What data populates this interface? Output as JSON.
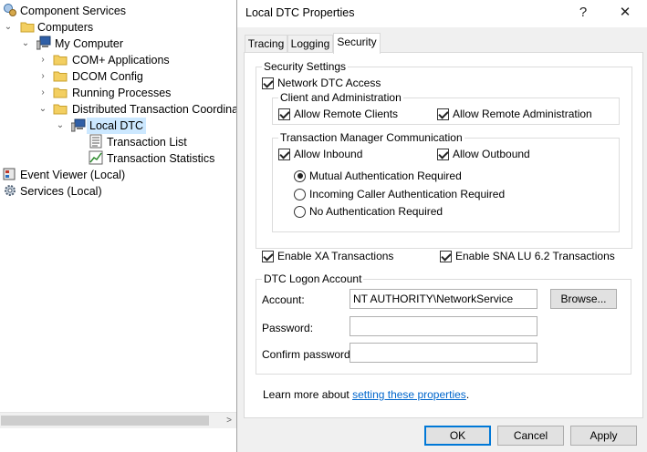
{
  "tree": {
    "items": [
      {
        "label": "Component Services",
        "icon": "component-services-icon",
        "expand": ""
      },
      {
        "label": "Computers",
        "icon": "folder-icon",
        "expand": "expanded"
      },
      {
        "label": "My Computer",
        "icon": "computer-icon",
        "expand": "expanded"
      },
      {
        "label": "COM+ Applications",
        "icon": "folder-icon",
        "expand": "collapsed"
      },
      {
        "label": "DCOM Config",
        "icon": "folder-icon",
        "expand": "collapsed"
      },
      {
        "label": "Running Processes",
        "icon": "folder-icon",
        "expand": "collapsed"
      },
      {
        "label": "Distributed Transaction Coordinat",
        "icon": "folder-icon",
        "expand": "expanded"
      },
      {
        "label": "Local DTC",
        "icon": "local-dtc-icon",
        "expand": "expanded",
        "selected": true
      },
      {
        "label": "Transaction List",
        "icon": "list-icon",
        "expand": ""
      },
      {
        "label": "Transaction Statistics",
        "icon": "statistics-icon",
        "expand": ""
      },
      {
        "label": "Event Viewer (Local)",
        "icon": "event-viewer-icon",
        "expand": ""
      },
      {
        "label": "Services (Local)",
        "icon": "services-gear-icon",
        "expand": ""
      }
    ]
  },
  "dialog": {
    "title": "Local DTC Properties",
    "help": "?",
    "close": "✕",
    "tabs": [
      "Tracing",
      "Logging",
      "Security"
    ],
    "active_tab": "Security",
    "security_settings": {
      "legend": "Security Settings",
      "network_dtc_access": {
        "label": "Network DTC Access",
        "checked": true
      },
      "client_admin": {
        "legend": "Client and Administration",
        "allow_remote_clients": {
          "label": "Allow Remote Clients",
          "checked": true
        },
        "allow_remote_admin": {
          "label": "Allow Remote Administration",
          "checked": true
        }
      },
      "tm_comm": {
        "legend": "Transaction Manager Communication",
        "allow_inbound": {
          "label": "Allow Inbound",
          "checked": true
        },
        "allow_outbound": {
          "label": "Allow Outbound",
          "checked": true
        },
        "auth_options": [
          {
            "label": "Mutual Authentication Required",
            "checked": true
          },
          {
            "label": "Incoming Caller Authentication Required",
            "checked": false
          },
          {
            "label": "No Authentication Required",
            "checked": false
          }
        ]
      },
      "enable_xa": {
        "label": "Enable XA Transactions",
        "checked": true
      },
      "enable_sna": {
        "label": "Enable SNA LU 6.2 Transactions",
        "checked": true
      }
    },
    "logon": {
      "legend": "DTC Logon Account",
      "account_label": "Account:",
      "account_value": "NT AUTHORITY\\NetworkService",
      "browse": "Browse...",
      "password_label": "Password:",
      "password_value": "",
      "confirm_label": "Confirm password:",
      "confirm_value": ""
    },
    "learn_prefix": "Learn more about ",
    "learn_link": "setting these properties",
    "learn_suffix": ".",
    "buttons": {
      "ok": "OK",
      "cancel": "Cancel",
      "apply": "Apply"
    }
  }
}
